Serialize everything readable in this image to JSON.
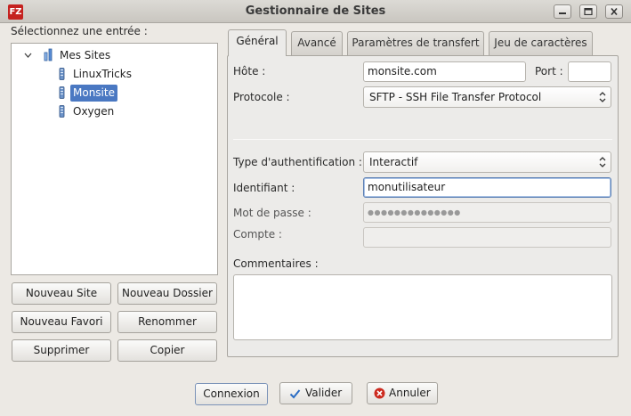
{
  "window": {
    "title": "Gestionnaire de Sites",
    "app_icon_text": "FZ",
    "controls": [
      "minimize",
      "maximize",
      "close"
    ]
  },
  "left": {
    "select_label": "Sélectionnez une entrée :",
    "tree": {
      "root": "Mes Sites",
      "items": [
        "LinuxTricks",
        "Monsite",
        "Oxygen"
      ],
      "selected": "Monsite"
    },
    "buttons": {
      "new_site": "Nouveau Site",
      "new_folder": "Nouveau Dossier",
      "new_bookmark": "Nouveau Favori",
      "rename": "Renommer",
      "delete": "Supprimer",
      "copy": "Copier"
    }
  },
  "tabs": [
    "Général",
    "Avancé",
    "Paramètres de transfert",
    "Jeu de caractères"
  ],
  "active_tab": "Général",
  "general": {
    "host_label": "Hôte :",
    "host_value": "monsite.com",
    "port_label": "Port :",
    "port_value": "",
    "protocol_label": "Protocole :",
    "protocol_value": "SFTP - SSH File Transfer Protocol",
    "auth_label": "Type d'authentification :",
    "auth_value": "Interactif",
    "user_label": "Identifiant :",
    "user_value": "monutilisateur",
    "password_label": "Mot de passe :",
    "password_value": "●●●●●●●●●●●●●●",
    "account_label": "Compte :",
    "account_value": "",
    "comments_label": "Commentaires :",
    "comments_value": ""
  },
  "footer": {
    "connect": "Connexion",
    "ok": "Valider",
    "cancel": "Annuler"
  },
  "colors": {
    "selection": "#4a78c2",
    "app_icon": "#c5221f",
    "ok_check": "#2a6cc4",
    "cancel_icon": "#cc2a1f"
  }
}
